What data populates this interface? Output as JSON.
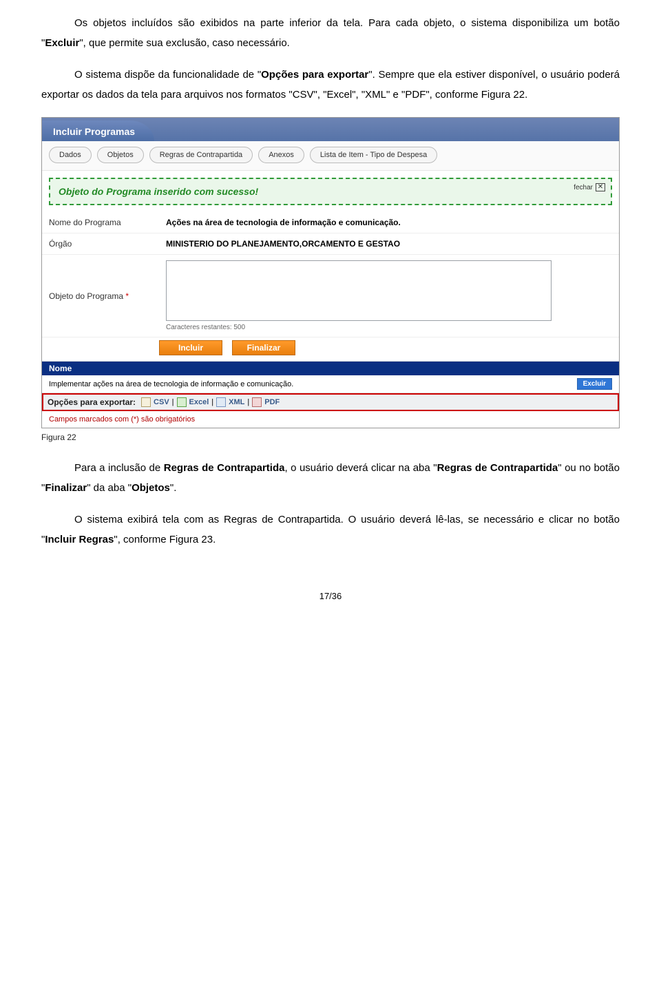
{
  "doc": {
    "para1_pre": "Os objetos incluídos são exibidos na parte inferior da tela. Para cada objeto, o sistema disponibiliza um botão \"",
    "para1_b1": "Excluir",
    "para1_post": "\", que permite sua exclusão, caso necessário.",
    "para2_pre": "O sistema dispõe da funcionalidade de \"",
    "para2_b1": "Opções para exportar",
    "para2_post": "\". Sempre que ela estiver disponível, o usuário poderá exportar os dados da tela para arquivos nos formatos \"CSV\", \"Excel\", \"XML\" e \"PDF\", conforme Figura 22.",
    "para3_pre": "Para a inclusão de ",
    "para3_b1": "Regras de Contrapartida",
    "para3_mid1": ", o usuário deverá clicar na aba \"",
    "para3_b2": "Regras de Contrapartida",
    "para3_mid2": "\" ou no botão \"",
    "para3_b3": "Finalizar",
    "para3_mid3": "\" da aba \"",
    "para3_b4": "Objetos",
    "para3_post": "\".",
    "para4_pre": "O sistema exibirá tela com as Regras de Contrapartida. O usuário deverá lê-las, se necessário e clicar no botão \"",
    "para4_b1": "Incluir Regras",
    "para4_post": "\", conforme Figura 23."
  },
  "ui": {
    "title": "Incluir Programas",
    "tabs": [
      "Dados",
      "Objetos",
      "Regras de Contrapartida",
      "Anexos",
      "Lista de Item - Tipo de Despesa"
    ],
    "success_msg": "Objeto do Programa inserido com sucesso!",
    "close_label": "fechar",
    "fields": {
      "nome_programa_label": "Nome do Programa",
      "nome_programa_value": "Ações na área de tecnologia de informação e comunicação.",
      "orgao_label": "Órgão",
      "orgao_value": "MINISTERIO DO PLANEJAMENTO,ORCAMENTO E GESTAO",
      "objeto_label": "Objeto do Programa",
      "chars_remaining": "Caracteres restantes: 500"
    },
    "buttons": {
      "incluir": "Incluir",
      "finalizar": "Finalizar"
    },
    "list_header": "Nome",
    "list_row_text": "Implementar ações na área de tecnologia de informação e comunicação.",
    "excluir_btn": "Excluir",
    "export": {
      "label": "Opções para exportar:",
      "csv": "CSV",
      "excel": "Excel",
      "xml": "XML",
      "pdf": "PDF",
      "sep": "|"
    },
    "mandatory_note": "Campos marcados com (*) são obrigatórios"
  },
  "figure_caption": "Figura 22",
  "page_number": "17/36"
}
